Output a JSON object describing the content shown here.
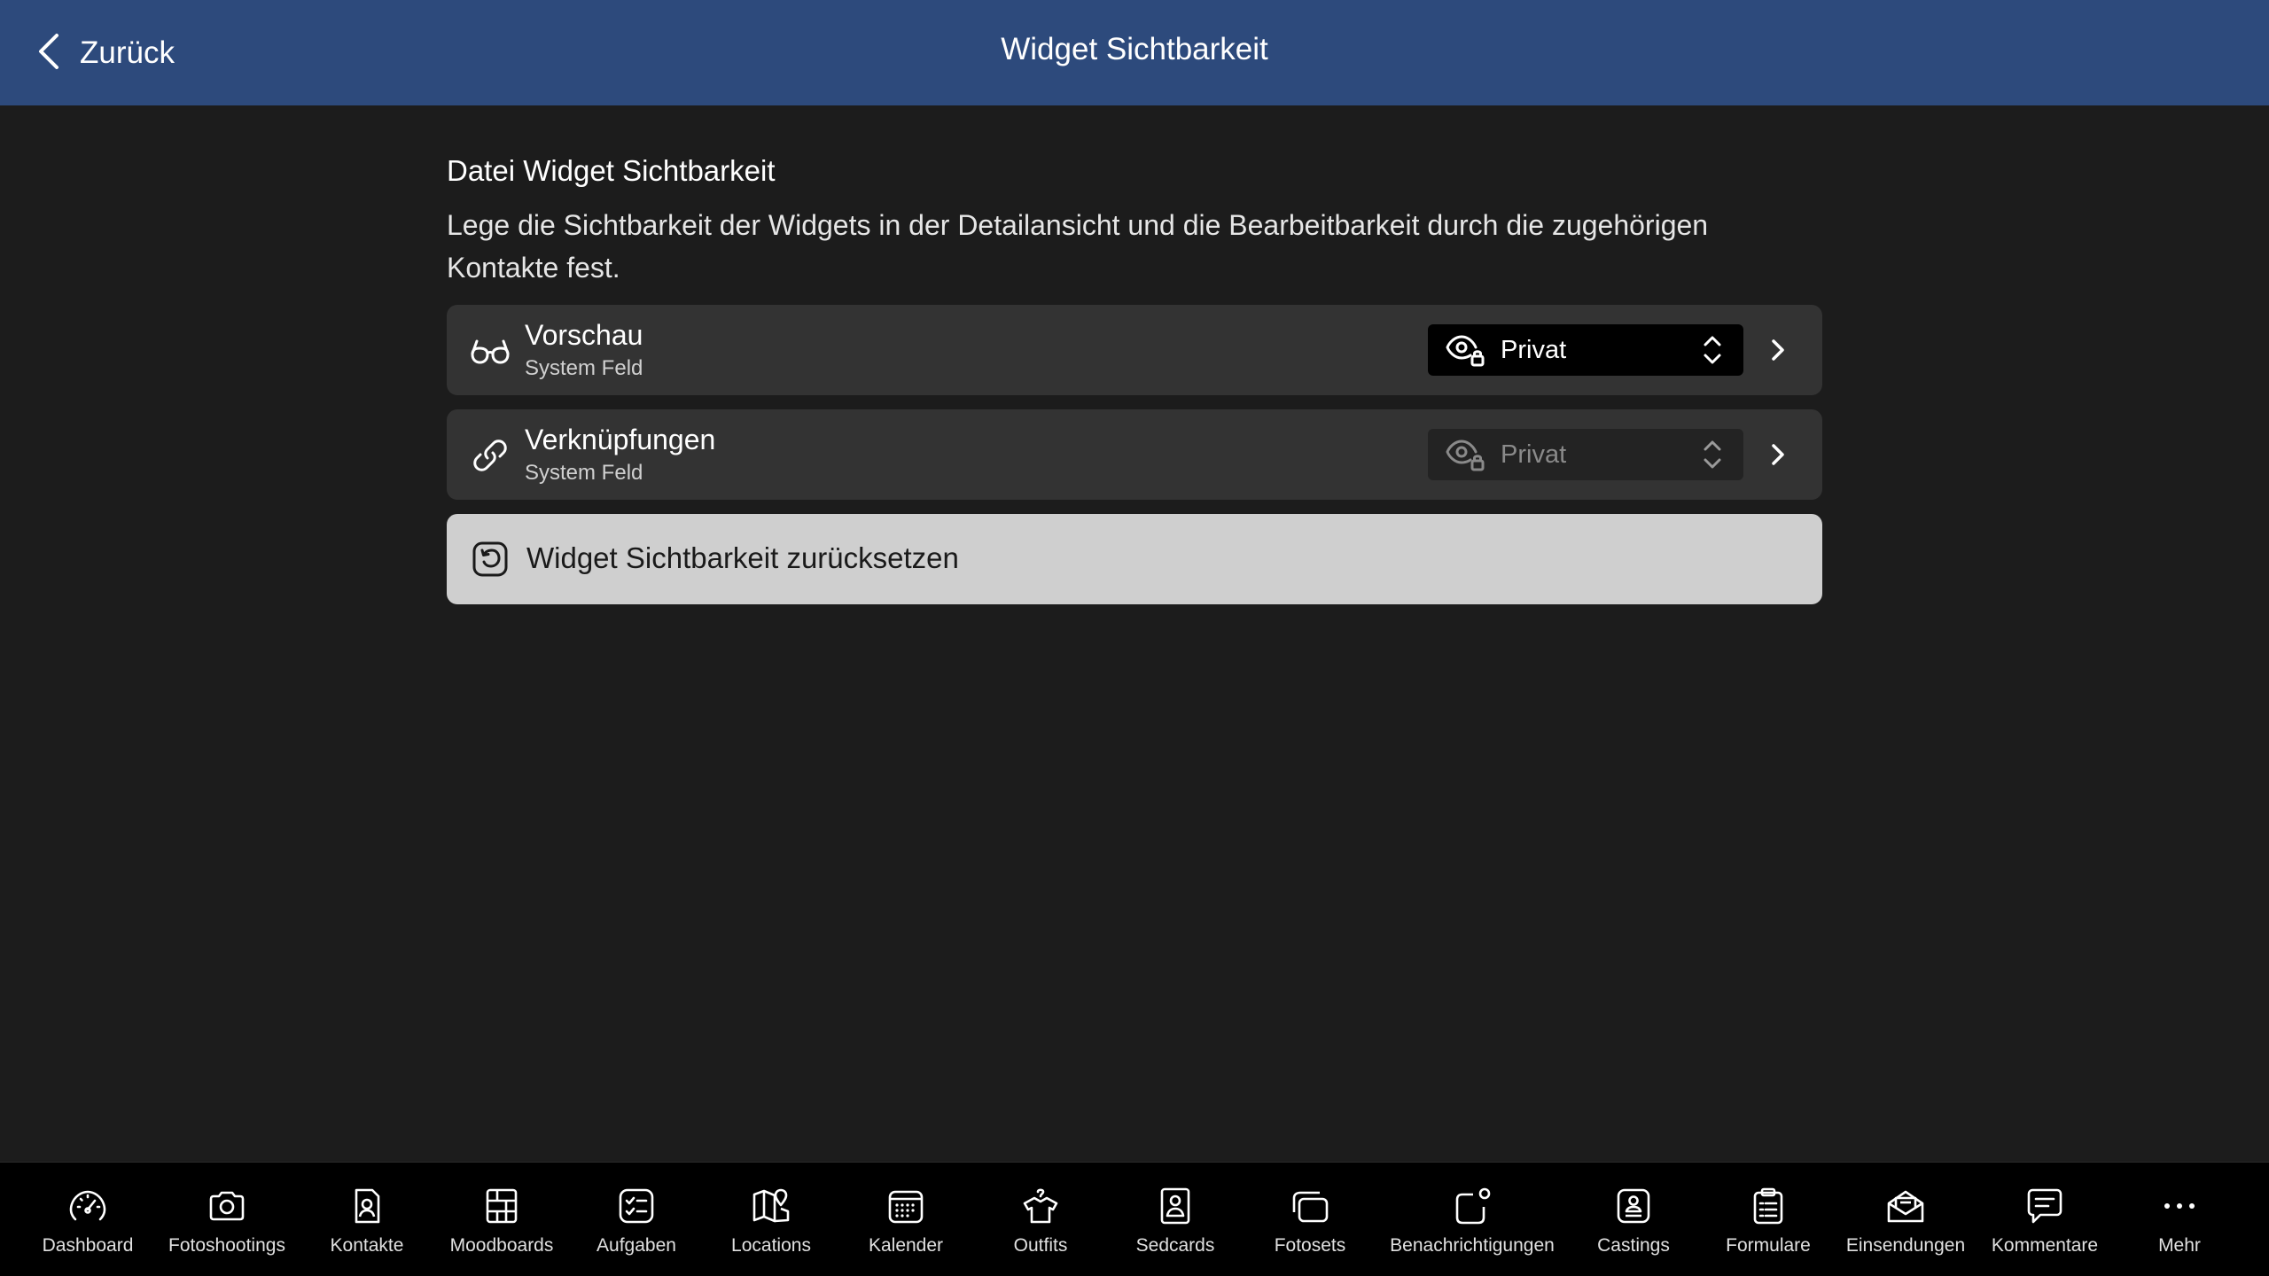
{
  "header": {
    "back_label": "Zurück",
    "title": "Widget Sichtbarkeit"
  },
  "section": {
    "title": "Datei Widget Sichtbarkeit",
    "description": "Lege die Sichtbarkeit der Widgets in der Detailansicht und die Bearbeitbarkeit durch die zugehörigen Kontakte fest."
  },
  "widgets": [
    {
      "icon": "glasses-icon",
      "title": "Vorschau",
      "subtitle": "System Feld",
      "visibility": "Privat",
      "enabled": true
    },
    {
      "icon": "link-icon",
      "title": "Verknüpfungen",
      "subtitle": "System Feld",
      "visibility": "Privat",
      "enabled": false
    }
  ],
  "reset": {
    "icon": "reset-icon",
    "label": "Widget Sichtbarkeit zurücksetzen"
  },
  "tabbar": [
    {
      "icon": "speedometer-icon",
      "label": "Dashboard"
    },
    {
      "icon": "camera-icon",
      "label": "Fotoshootings"
    },
    {
      "icon": "contact-icon",
      "label": "Kontakte"
    },
    {
      "icon": "moodboard-icon",
      "label": "Moodboards"
    },
    {
      "icon": "checklist-icon",
      "label": "Aufgaben"
    },
    {
      "icon": "map-icon",
      "label": "Locations"
    },
    {
      "icon": "calendar-icon",
      "label": "Kalender"
    },
    {
      "icon": "hanger-icon",
      "label": "Outfits"
    },
    {
      "icon": "sedcard-icon",
      "label": "Sedcards"
    },
    {
      "icon": "photoset-icon",
      "label": "Fotosets"
    },
    {
      "icon": "notification-icon",
      "label": "Benachrichtigungen"
    },
    {
      "icon": "casting-icon",
      "label": "Castings"
    },
    {
      "icon": "clipboard-icon",
      "label": "Formulare"
    },
    {
      "icon": "envelope-icon",
      "label": "Einsendungen"
    },
    {
      "icon": "comment-icon",
      "label": "Kommentare"
    },
    {
      "icon": "more-icon",
      "label": "Mehr"
    }
  ],
  "colors": {
    "header_bg": "#2d4a7c",
    "background": "#1c1c1c",
    "row_bg": "#333333",
    "reset_bg": "#cfcfcf"
  }
}
